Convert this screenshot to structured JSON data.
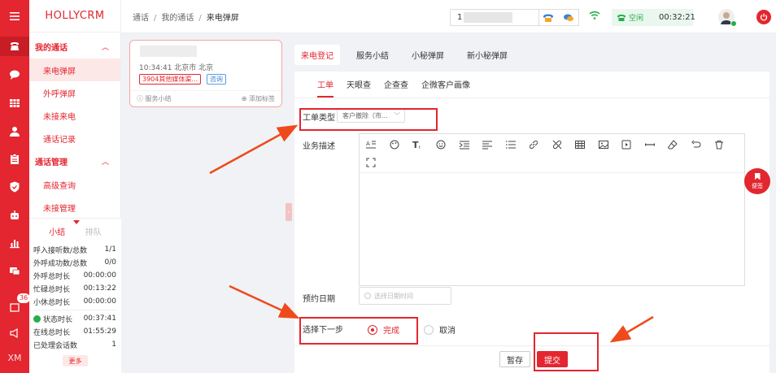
{
  "app": {
    "logo": "HOLLYCRM"
  },
  "rail": {
    "badge_count": "36",
    "user_initials": "XM"
  },
  "menu": {
    "group1": "我的通话",
    "group1_items": [
      "来电弹屏",
      "外呼弹屏",
      "未接来电",
      "通话记录"
    ],
    "group2": "通话管理",
    "group2_items": [
      "高级查询",
      "未接管理"
    ]
  },
  "stats": {
    "tab_on": "小结",
    "tab_off": "排队",
    "rows": [
      {
        "label": "呼入接听数/总数",
        "value": "1/1"
      },
      {
        "label": "外呼成功数/总数",
        "value": "0/0"
      },
      {
        "label": "外呼总时长",
        "value": "00:00:00"
      },
      {
        "label": "忙碌总时长",
        "value": "00:13:22"
      },
      {
        "label": "小休总时长",
        "value": "00:00:00"
      }
    ],
    "rows2": [
      {
        "label": "状态时长",
        "value": "00:37:41"
      },
      {
        "label": "在线总时长",
        "value": "01:55:29"
      },
      {
        "label": "已处理会话数",
        "value": "1"
      }
    ],
    "more": "更多"
  },
  "topbar": {
    "breadcrumb": [
      "通话",
      "我的通话",
      "来电弹屏"
    ],
    "phone_prefix": "1",
    "status": "空闲",
    "timer": "00:32:21"
  },
  "card": {
    "time_location": "10:34:41 北京市 北京",
    "tag_type": "3904其他媒体渠...",
    "tag_consult": "咨询",
    "summary": "服务小结",
    "add_tag": "添加标签"
  },
  "main_tabs": [
    "来电登记",
    "服务小结",
    "小秘弹屏",
    "新小秘弹屏"
  ],
  "sub_tabs": [
    "工单",
    "天眼查",
    "企查查",
    "企微客户画像"
  ],
  "form": {
    "type_label": "工单类型",
    "type_value": "客户撤除（市...",
    "desc_label": "业务描述",
    "date_label": "预约日期",
    "date_placeholder": "选择日期时间",
    "next_label": "选择下一步",
    "option_done": "完成",
    "option_cancel": "取消"
  },
  "buttons": {
    "save": "暂存",
    "submit": "提交"
  },
  "float": {
    "label": "便签"
  },
  "colors": {
    "brand": "#e3262f",
    "ok": "#27ae4a",
    "link": "#3b82d6"
  }
}
